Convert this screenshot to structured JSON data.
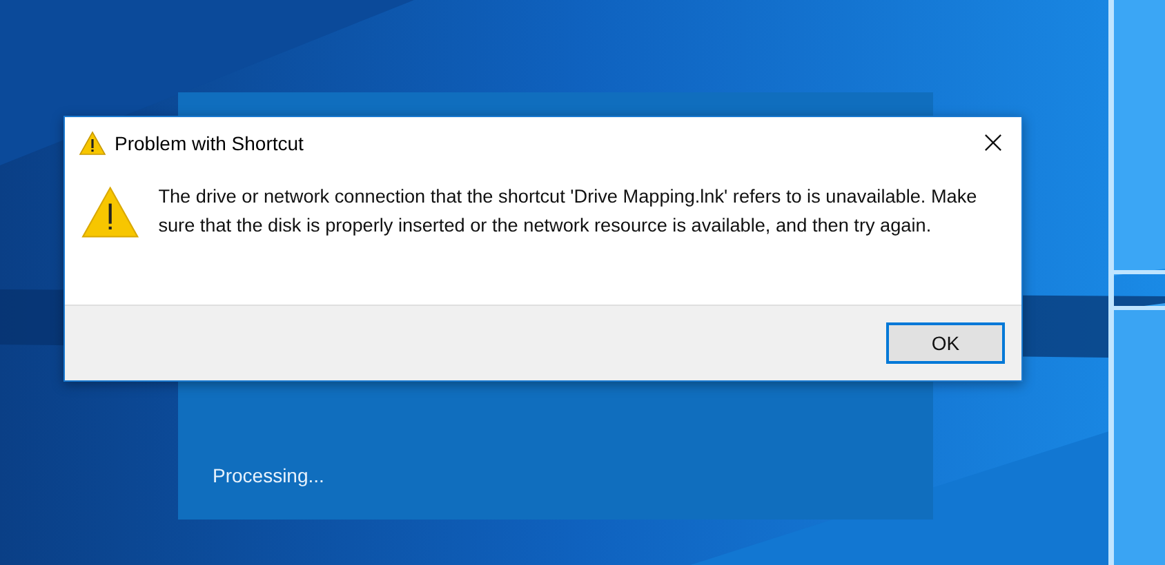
{
  "progress_panel": {
    "status": "Processing..."
  },
  "dialog": {
    "title": "Problem with Shortcut",
    "message": "The drive or network connection that the shortcut 'Drive Mapping.lnk' refers to is unavailable. Make sure that the disk is properly inserted or the network resource is available, and then try again.",
    "buttons": [
      {
        "label": "OK",
        "default": true
      }
    ]
  }
}
